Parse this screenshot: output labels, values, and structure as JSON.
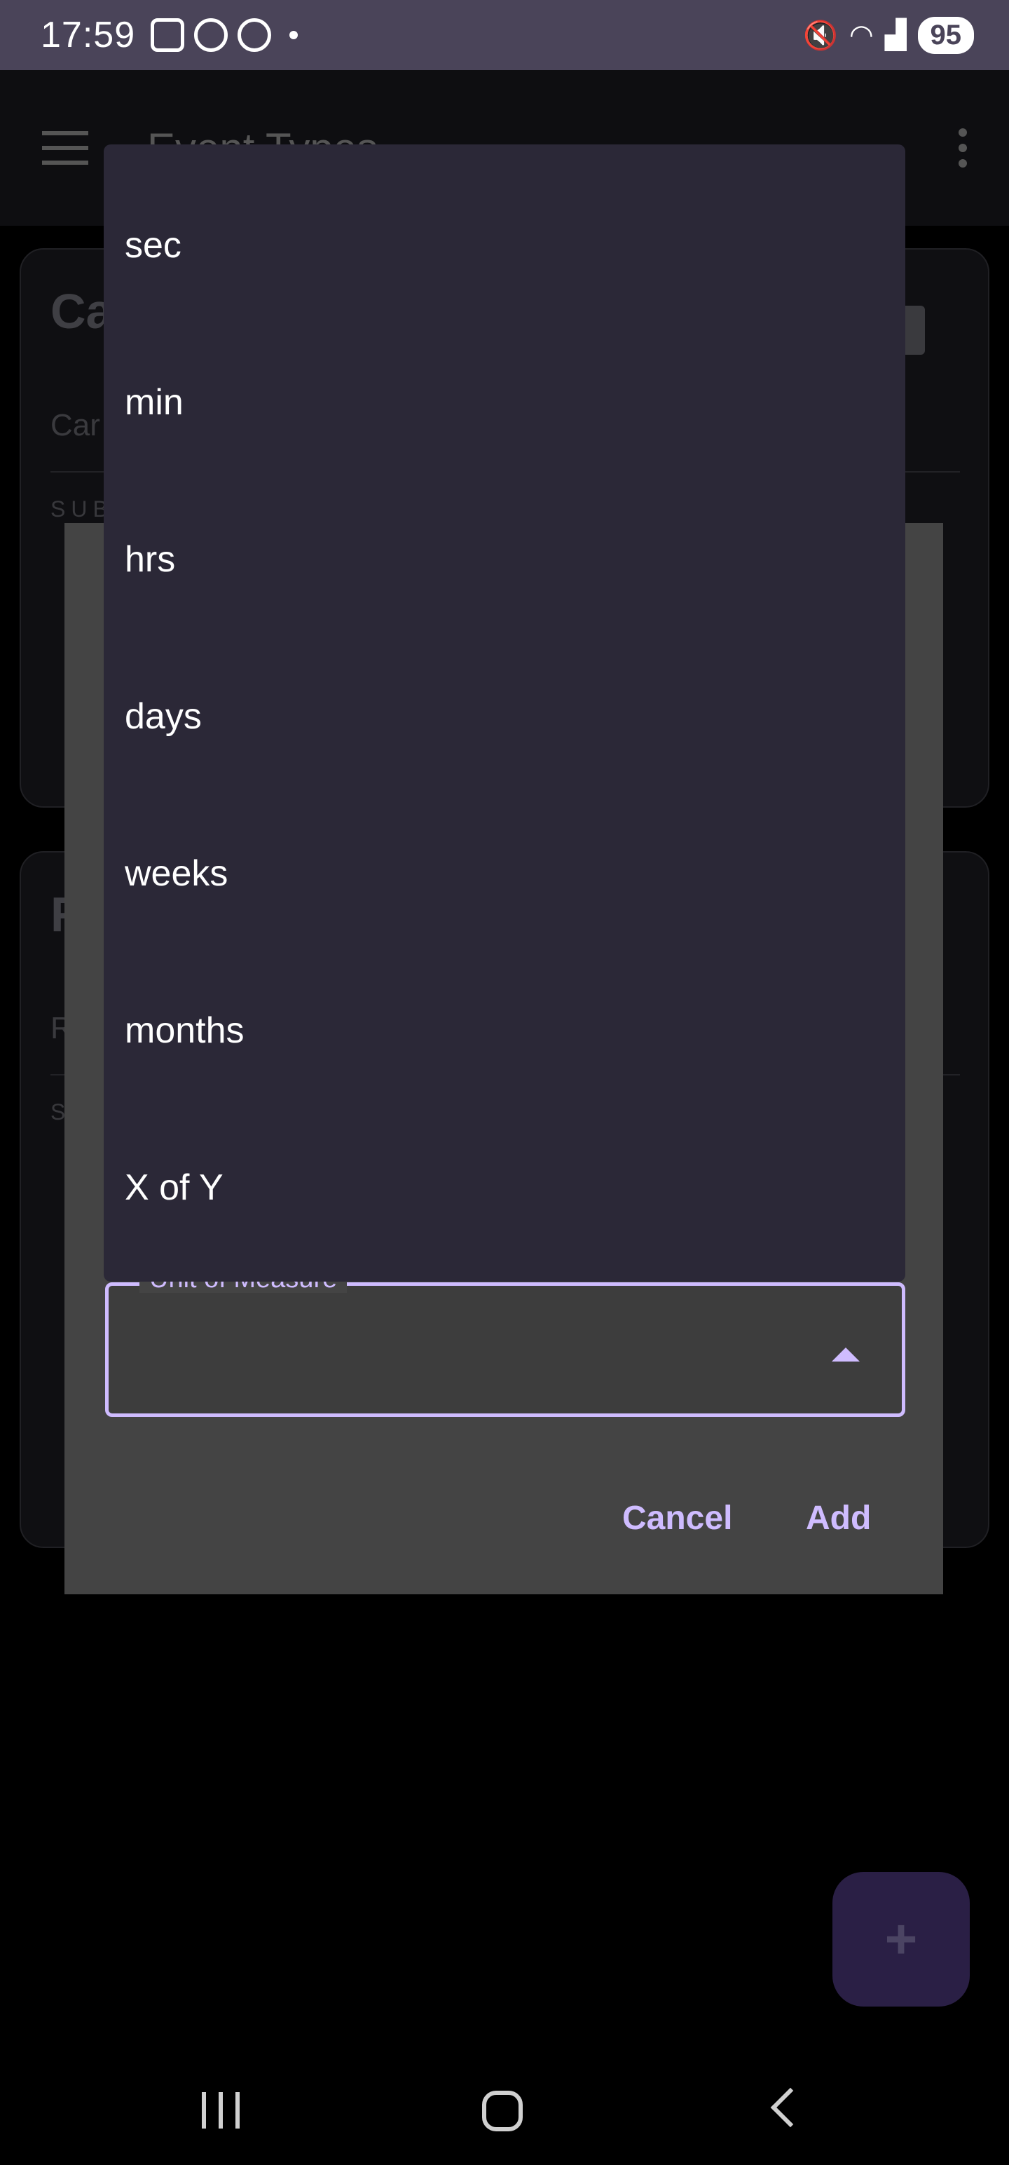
{
  "status_bar": {
    "time": "17:59",
    "battery": "95",
    "left_icons": [
      "screenshot-icon",
      "target-icon",
      "battery-saver-icon",
      "notification-dot"
    ],
    "right_icons": [
      "mute-icon",
      "wifi-icon",
      "signal-icon"
    ]
  },
  "app_bar": {
    "title": "Event Types"
  },
  "background_cards": [
    {
      "title": "Ca",
      "subtitle": "Car",
      "section": "SUB"
    },
    {
      "title": "R",
      "subtitle": "R",
      "section": "S"
    }
  ],
  "dialog": {
    "field_label": "Unit of Measure",
    "field_value": "",
    "cancel_label": "Cancel",
    "add_label": "Add"
  },
  "dropdown": {
    "options": [
      "sec",
      "min",
      "hrs",
      "days",
      "weeks",
      "months",
      "X of Y"
    ]
  },
  "fab": {
    "symbol": "+"
  },
  "colors": {
    "accent": "#cfbcff",
    "menu_bg": "#2b2837",
    "dialog_bg": "#444444",
    "status_bar_bg": "#4a4459"
  }
}
